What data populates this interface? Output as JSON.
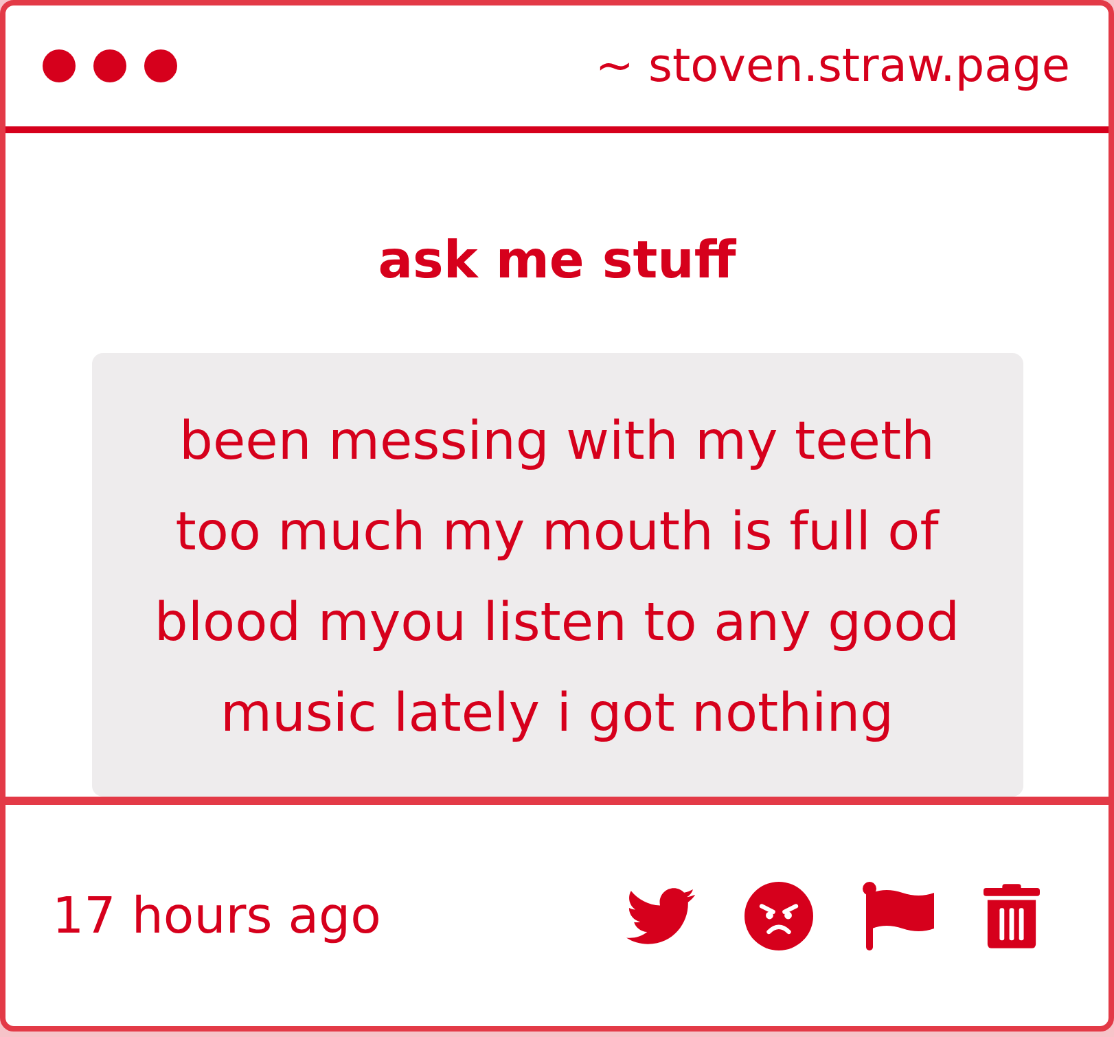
{
  "window": {
    "address": "~ stoven.straw.page"
  },
  "title": "ask me stuff",
  "question": "been messing with my teeth too much my mouth is full of blood myou listen to any good music lately i got nothing",
  "footer": {
    "time": "17 hours ago"
  }
}
